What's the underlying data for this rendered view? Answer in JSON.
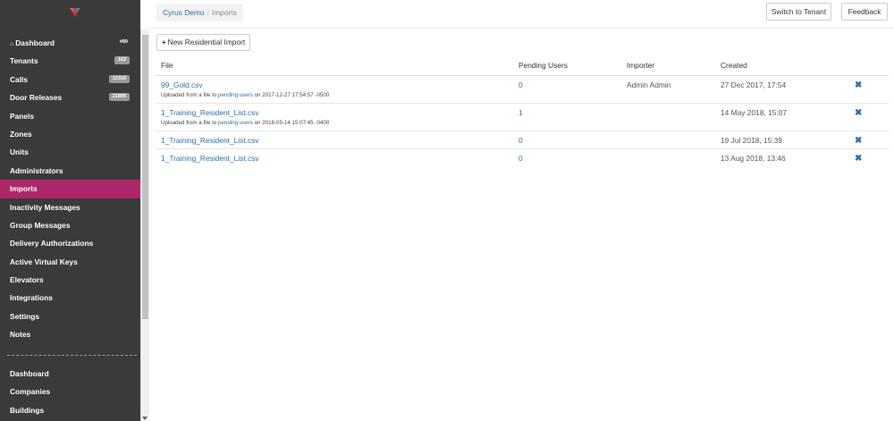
{
  "sidebar": {
    "items": [
      {
        "label": "Dashboard",
        "badge": "#89",
        "badge_style": "plain",
        "icon": "home-icon"
      },
      {
        "label": "Tenants",
        "badge": "163"
      },
      {
        "label": "Calls",
        "badge": "13316"
      },
      {
        "label": "Door Releases",
        "badge": "21895"
      },
      {
        "label": "Panels"
      },
      {
        "label": "Zones"
      },
      {
        "label": "Units"
      },
      {
        "label": "Administrators"
      },
      {
        "label": "Imports",
        "active": true
      },
      {
        "label": "Inactivity Messages"
      },
      {
        "label": "Group Messages"
      },
      {
        "label": "Delivery Authorizations"
      },
      {
        "label": "Active Virtual Keys"
      },
      {
        "label": "Elevators"
      },
      {
        "label": "Integrations"
      },
      {
        "label": "Settings"
      },
      {
        "label": "Notes"
      }
    ],
    "secondary_items": [
      {
        "label": "Dashboard"
      },
      {
        "label": "Companies"
      },
      {
        "label": "Buildings"
      }
    ],
    "active_color": "#ad2769",
    "background": "#3a3a3a"
  },
  "breadcrumb": {
    "parent": "Cyrus Demo",
    "separator": "/",
    "current": "Imports"
  },
  "header": {
    "switch_label": "Switch to Tenant",
    "feedback_label": "Feedback"
  },
  "toolbar": {
    "new_import_icon": "+",
    "new_import_label": "New Residential Import"
  },
  "table": {
    "columns": [
      "File",
      "Pending Users",
      "Importer",
      "Created"
    ],
    "rows": [
      {
        "file": "99_Gold.csv",
        "note_prefix": "Uploaded from a file to",
        "note_link": "pending users",
        "note_suffix": "on 2017-12-27 17:54:57 -0500",
        "pending": "0",
        "importer": "Admin Admin",
        "created": "27 Dec 2017, 17:54",
        "delete_icon": "✖"
      },
      {
        "file": "1_Training_Resident_List.csv",
        "note_prefix": "Uploaded from a file to",
        "note_link": "pending users",
        "note_suffix": "on 2018-05-14 15:07:45 -0400",
        "pending": "1",
        "importer": "",
        "created": "14 May 2018, 15:07",
        "delete_icon": "✖"
      },
      {
        "file": "1_Training_Resident_List.csv",
        "pending": "0",
        "importer": "",
        "created": "19 Jul 2018, 15:39",
        "delete_icon": "✖"
      },
      {
        "file": "1_Training_Resident_List.csv",
        "pending": "0",
        "importer": "",
        "created": "13 Aug 2018, 13:46",
        "delete_icon": "✖"
      }
    ]
  },
  "colors": {
    "link": "#2c6ea6",
    "accent": "#ad2769"
  }
}
